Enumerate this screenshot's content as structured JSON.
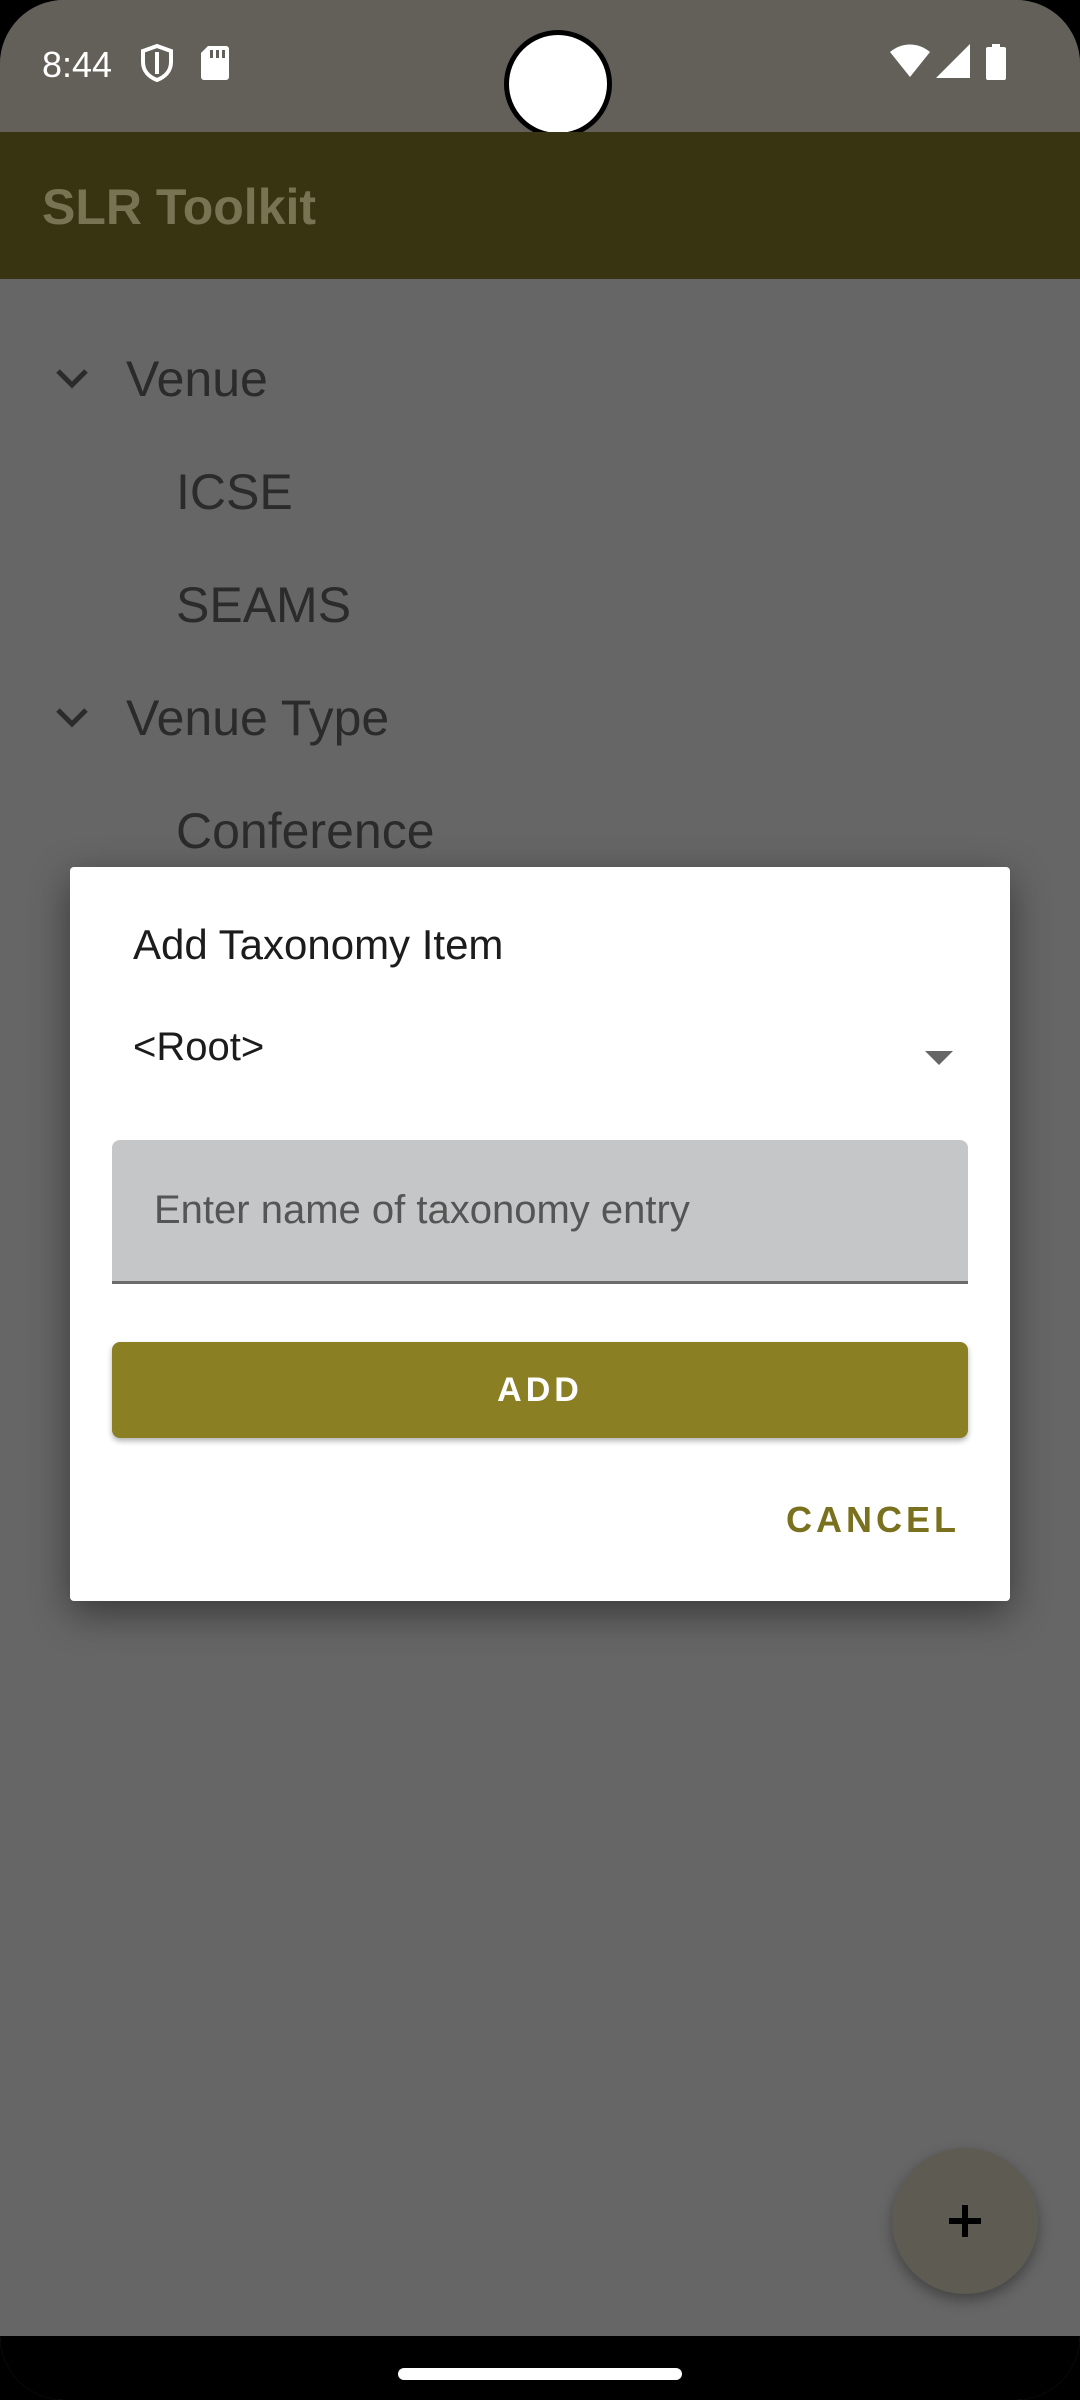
{
  "status_bar": {
    "time": "8:44"
  },
  "app_bar": {
    "title": "SLR Toolkit"
  },
  "tree": {
    "items": [
      {
        "label": "Venue",
        "expanded": true,
        "level": 0
      },
      {
        "label": "ICSE",
        "level": 1
      },
      {
        "label": "SEAMS",
        "level": 1
      },
      {
        "label": "Venue Type",
        "expanded": true,
        "level": 0
      },
      {
        "label": "Conference",
        "level": 1
      }
    ]
  },
  "dialog": {
    "title": "Add Taxonomy Item",
    "parent_select": {
      "selected": "<Root>"
    },
    "name_field": {
      "value": "",
      "placeholder": "Enter name of taxonomy entry"
    },
    "add_label": "ADD",
    "cancel_label": "CANCEL"
  },
  "colors": {
    "app_bar": "#383311",
    "accent": "#8a7f22",
    "cancel_text": "#7a711e",
    "scrim_background": "#666666"
  },
  "icons": {
    "status": [
      "shield-icon",
      "sd-card-icon",
      "wifi-icon",
      "signal-icon",
      "battery-icon"
    ],
    "tree": "chevron-down-icon",
    "dropdown": "dropdown-arrow-icon",
    "fab": "plus-icon"
  }
}
